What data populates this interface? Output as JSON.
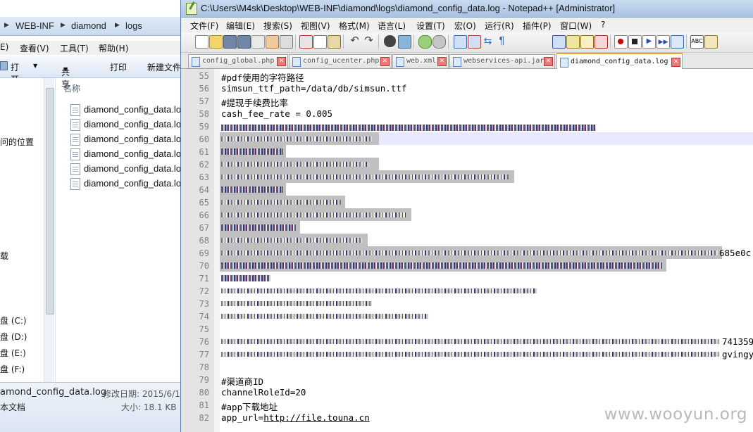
{
  "explorer": {
    "breadcrumb": [
      "WEB-INF",
      "diamond",
      "logs"
    ],
    "menu": [
      "E)",
      "查看(V)",
      "工具(T)",
      "帮助(H)"
    ],
    "toolbar": {
      "open": "打开",
      "share": "共享",
      "print": "打印",
      "new_folder": "新建文件"
    },
    "nav": [
      "问的位置",
      "载",
      "盘 (C:)",
      "盘 (D:)",
      "盘 (E:)",
      "盘 (F:)"
    ],
    "column_header": "名称",
    "files": [
      "diamond_config_data.log",
      "diamond_config_data.log",
      "diamond_config_data.log",
      "diamond_config_data.log",
      "diamond_config_data.log",
      "diamond_config_data.log"
    ],
    "status": {
      "filename": "amond_config_data.log",
      "modified_label": "修改日期: 2015/6/1",
      "type": "本文档",
      "size": "大小: 18.1 KB"
    }
  },
  "npp": {
    "title": "C:\\Users\\M4sk\\Desktop\\WEB-INF\\diamond\\logs\\diamond_config_data.log - Notepad++ [Administrator]",
    "menu": [
      "文件(F)",
      "编辑(E)",
      "搜索(S)",
      "视图(V)",
      "格式(M)",
      "语言(L)",
      "设置(T)",
      "宏(O)",
      "运行(R)",
      "插件(P)",
      "窗口(W)",
      "?"
    ],
    "tabs": [
      {
        "label": "config_global.php",
        "active": false
      },
      {
        "label": "config_ucenter.php",
        "active": false
      },
      {
        "label": "web.xml",
        "active": false
      },
      {
        "label": "webservices-api.jar",
        "active": false
      },
      {
        "label": "diamond_config_data.log",
        "active": true
      }
    ],
    "line_numbers": [
      "55",
      "56",
      "57",
      "58",
      "59",
      "60",
      "61",
      "62",
      "63",
      "64",
      "65",
      "66",
      "67",
      "68",
      "69",
      "70",
      "71",
      "72",
      "73",
      "74",
      "75",
      "76",
      "77",
      "78",
      "79",
      "80",
      "81",
      "82"
    ],
    "visible_lines": {
      "l55": "#pdf使用的字符路径",
      "l56": "simsun_ttf_path=/data/db/simsun.ttf",
      "l57": "#提现手续费比率",
      "l58": "cash_fee_rate = 0.005",
      "l69_tail": "685e0c",
      "l76_tail": "741359",
      "l77_tail": "gvingy",
      "l79": "#渠道商ID",
      "l80": "channelRoleId=20",
      "l81": "#app下载地址",
      "l82_key": "app_url=",
      "l82_url": "http://file.touna.cn"
    }
  },
  "watermark": "www.wooyun.org"
}
